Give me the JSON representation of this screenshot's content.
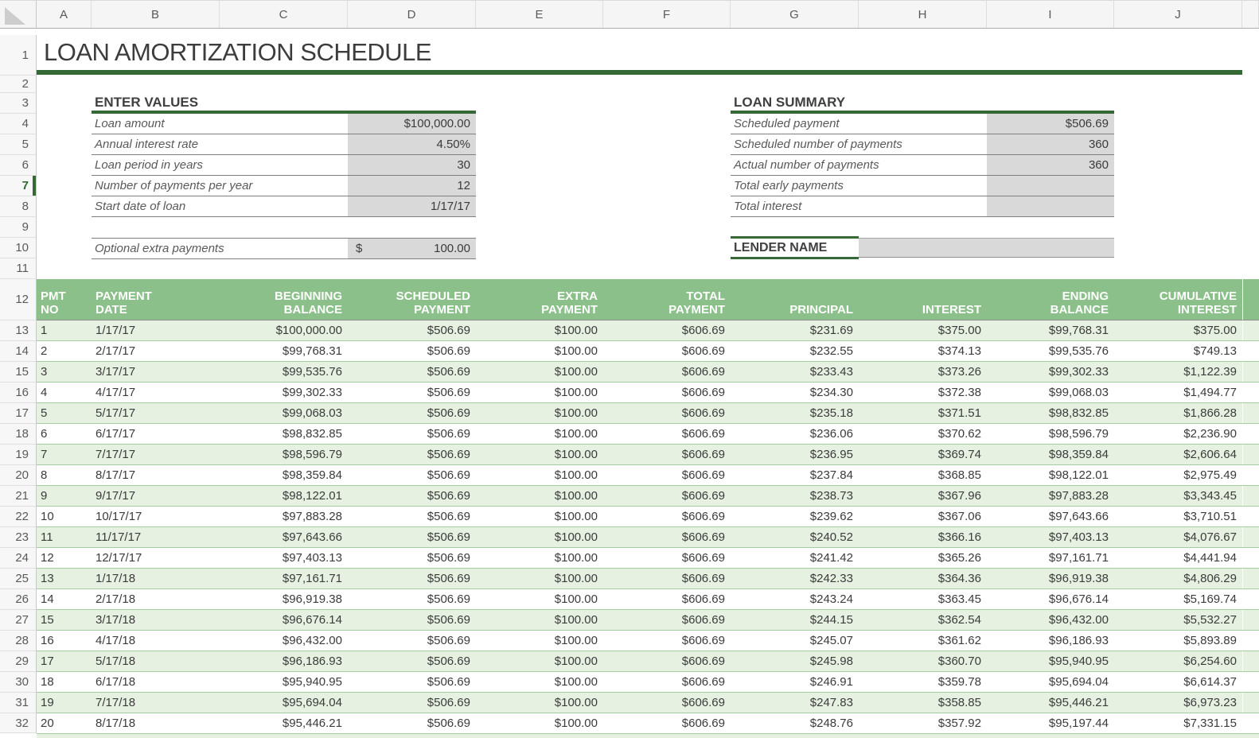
{
  "title": "LOAN AMORTIZATION SCHEDULE",
  "column_headers": [
    "A",
    "B",
    "C",
    "D",
    "E",
    "F",
    "G",
    "H",
    "I",
    "J"
  ],
  "row_headers": [
    1,
    2,
    3,
    4,
    5,
    6,
    7,
    8,
    9,
    10,
    11,
    12,
    13,
    14,
    15,
    16,
    17,
    18,
    19,
    20,
    21,
    22,
    23,
    24,
    25,
    26,
    27,
    28,
    29,
    30,
    31,
    32
  ],
  "selected_row": 7,
  "colors": {
    "dark_green": "#356935",
    "header_green": "#8cc08a",
    "band_green": "#e6f1e1",
    "input_gray": "#d9d9d9"
  },
  "enter_values": {
    "heading": "ENTER VALUES",
    "rows": [
      {
        "label": "Loan amount",
        "value": "$100,000.00"
      },
      {
        "label": "Annual interest rate",
        "value": "4.50%"
      },
      {
        "label": "Loan period in years",
        "value": "30"
      },
      {
        "label": "Number of payments per year",
        "value": "12"
      },
      {
        "label": "Start date of loan",
        "value": "1/17/17"
      }
    ],
    "extra": {
      "label": "Optional extra payments",
      "currency": "$",
      "value": "100.00"
    }
  },
  "loan_summary": {
    "heading": "LOAN SUMMARY",
    "rows": [
      {
        "label": "Scheduled payment",
        "value": "$506.69"
      },
      {
        "label": "Scheduled number of payments",
        "value": "360"
      },
      {
        "label": "Actual number of payments",
        "value": "360"
      },
      {
        "label": "Total early payments",
        "value": ""
      },
      {
        "label": "Total interest",
        "value": ""
      }
    ]
  },
  "lender": {
    "heading": "LENDER NAME",
    "value": ""
  },
  "schedule": {
    "headers": [
      {
        "line1": "PMT",
        "line2": "NO",
        "align": "txt"
      },
      {
        "line1": "PAYMENT",
        "line2": "DATE",
        "align": "txt"
      },
      {
        "line1": "BEGINNING",
        "line2": "BALANCE",
        "align": "num"
      },
      {
        "line1": "SCHEDULED",
        "line2": "PAYMENT",
        "align": "num"
      },
      {
        "line1": "EXTRA",
        "line2": "PAYMENT",
        "align": "num"
      },
      {
        "line1": "TOTAL",
        "line2": "PAYMENT",
        "align": "num"
      },
      {
        "line1": "",
        "line2": "PRINCIPAL",
        "align": "num"
      },
      {
        "line1": "",
        "line2": "INTEREST",
        "align": "num"
      },
      {
        "line1": "ENDING",
        "line2": "BALANCE",
        "align": "num"
      },
      {
        "line1": "CUMULATIVE",
        "line2": "INTEREST",
        "align": "num"
      }
    ],
    "rows": [
      [
        "1",
        "1/17/17",
        "$100,000.00",
        "$506.69",
        "$100.00",
        "$606.69",
        "$231.69",
        "$375.00",
        "$99,768.31",
        "$375.00"
      ],
      [
        "2",
        "2/17/17",
        "$99,768.31",
        "$506.69",
        "$100.00",
        "$606.69",
        "$232.55",
        "$374.13",
        "$99,535.76",
        "$749.13"
      ],
      [
        "3",
        "3/17/17",
        "$99,535.76",
        "$506.69",
        "$100.00",
        "$606.69",
        "$233.43",
        "$373.26",
        "$99,302.33",
        "$1,122.39"
      ],
      [
        "4",
        "4/17/17",
        "$99,302.33",
        "$506.69",
        "$100.00",
        "$606.69",
        "$234.30",
        "$372.38",
        "$99,068.03",
        "$1,494.77"
      ],
      [
        "5",
        "5/17/17",
        "$99,068.03",
        "$506.69",
        "$100.00",
        "$606.69",
        "$235.18",
        "$371.51",
        "$98,832.85",
        "$1,866.28"
      ],
      [
        "6",
        "6/17/17",
        "$98,832.85",
        "$506.69",
        "$100.00",
        "$606.69",
        "$236.06",
        "$370.62",
        "$98,596.79",
        "$2,236.90"
      ],
      [
        "7",
        "7/17/17",
        "$98,596.79",
        "$506.69",
        "$100.00",
        "$606.69",
        "$236.95",
        "$369.74",
        "$98,359.84",
        "$2,606.64"
      ],
      [
        "8",
        "8/17/17",
        "$98,359.84",
        "$506.69",
        "$100.00",
        "$606.69",
        "$237.84",
        "$368.85",
        "$98,122.01",
        "$2,975.49"
      ],
      [
        "9",
        "9/17/17",
        "$98,122.01",
        "$506.69",
        "$100.00",
        "$606.69",
        "$238.73",
        "$367.96",
        "$97,883.28",
        "$3,343.45"
      ],
      [
        "10",
        "10/17/17",
        "$97,883.28",
        "$506.69",
        "$100.00",
        "$606.69",
        "$239.62",
        "$367.06",
        "$97,643.66",
        "$3,710.51"
      ],
      [
        "11",
        "11/17/17",
        "$97,643.66",
        "$506.69",
        "$100.00",
        "$606.69",
        "$240.52",
        "$366.16",
        "$97,403.13",
        "$4,076.67"
      ],
      [
        "12",
        "12/17/17",
        "$97,403.13",
        "$506.69",
        "$100.00",
        "$606.69",
        "$241.42",
        "$365.26",
        "$97,161.71",
        "$4,441.94"
      ],
      [
        "13",
        "1/17/18",
        "$97,161.71",
        "$506.69",
        "$100.00",
        "$606.69",
        "$242.33",
        "$364.36",
        "$96,919.38",
        "$4,806.29"
      ],
      [
        "14",
        "2/17/18",
        "$96,919.38",
        "$506.69",
        "$100.00",
        "$606.69",
        "$243.24",
        "$363.45",
        "$96,676.14",
        "$5,169.74"
      ],
      [
        "15",
        "3/17/18",
        "$96,676.14",
        "$506.69",
        "$100.00",
        "$606.69",
        "$244.15",
        "$362.54",
        "$96,432.00",
        "$5,532.27"
      ],
      [
        "16",
        "4/17/18",
        "$96,432.00",
        "$506.69",
        "$100.00",
        "$606.69",
        "$245.07",
        "$361.62",
        "$96,186.93",
        "$5,893.89"
      ],
      [
        "17",
        "5/17/18",
        "$96,186.93",
        "$506.69",
        "$100.00",
        "$606.69",
        "$245.98",
        "$360.70",
        "$95,940.95",
        "$6,254.60"
      ],
      [
        "18",
        "6/17/18",
        "$95,940.95",
        "$506.69",
        "$100.00",
        "$606.69",
        "$246.91",
        "$359.78",
        "$95,694.04",
        "$6,614.37"
      ],
      [
        "19",
        "7/17/18",
        "$95,694.04",
        "$506.69",
        "$100.00",
        "$606.69",
        "$247.83",
        "$358.85",
        "$95,446.21",
        "$6,973.23"
      ],
      [
        "20",
        "8/17/18",
        "$95,446.21",
        "$506.69",
        "$100.00",
        "$606.69",
        "$248.76",
        "$357.92",
        "$95,197.44",
        "$7,331.15"
      ]
    ]
  }
}
